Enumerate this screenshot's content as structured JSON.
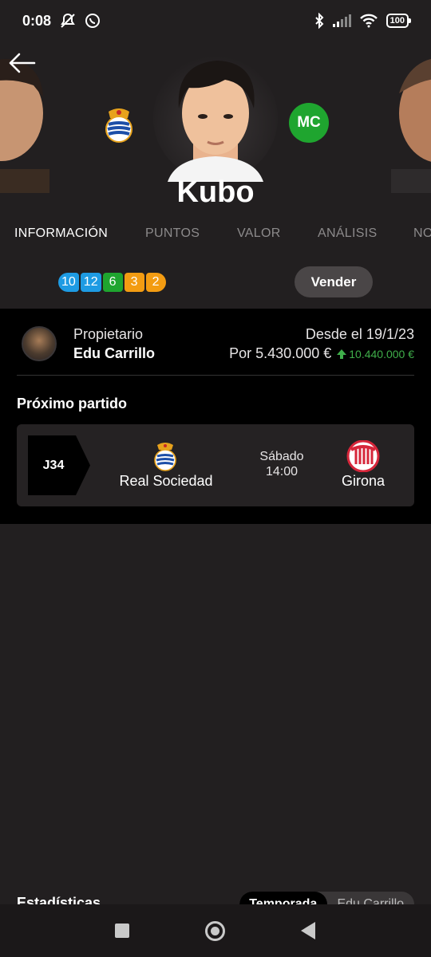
{
  "status_bar": {
    "time": "0:08",
    "battery": "100",
    "icons": [
      "mute-notifications-icon",
      "whatsapp-icon",
      "bluetooth-icon",
      "signal-icon",
      "wifi-icon",
      "battery-icon"
    ]
  },
  "player": {
    "name": "Kubo",
    "position": "MC",
    "club": "Real Sociedad"
  },
  "tabs": [
    {
      "label": "INFORMACIÓN",
      "active": true
    },
    {
      "label": "PUNTOS",
      "active": false
    },
    {
      "label": "VALOR",
      "active": false
    },
    {
      "label": "ANÁLISIS",
      "active": false
    },
    {
      "label": "NO",
      "active": false
    }
  ],
  "recent_points": [
    {
      "value": "10",
      "color": "#1e9be3"
    },
    {
      "value": "12",
      "color": "#1e9be3"
    },
    {
      "value": "6",
      "color": "#1fa52f"
    },
    {
      "value": "3",
      "color": "#f39c12"
    },
    {
      "value": "2",
      "color": "#f39c12"
    }
  ],
  "actions": {
    "sell_label": "Vender"
  },
  "ownership": {
    "owner_label": "Propietario",
    "owner_name": "Edu Carrillo",
    "since": "Desde el 19/1/23",
    "price": "Por 5.430.000 €",
    "gain": "10.440.000 €",
    "gain_color": "#3fae4a"
  },
  "next_match": {
    "title": "Próximo partido",
    "round": "J34",
    "home_team": "Real Sociedad",
    "day": "Sábado",
    "time": "14:00",
    "away_team": "Girona"
  },
  "stats": {
    "title": "Estadísticas",
    "toggle_options": [
      {
        "label": "Temporada",
        "active": true
      },
      {
        "label": "Edu Carrillo",
        "active": false
      }
    ]
  },
  "nav": [
    "recent-apps-button",
    "home-button",
    "back-button"
  ]
}
